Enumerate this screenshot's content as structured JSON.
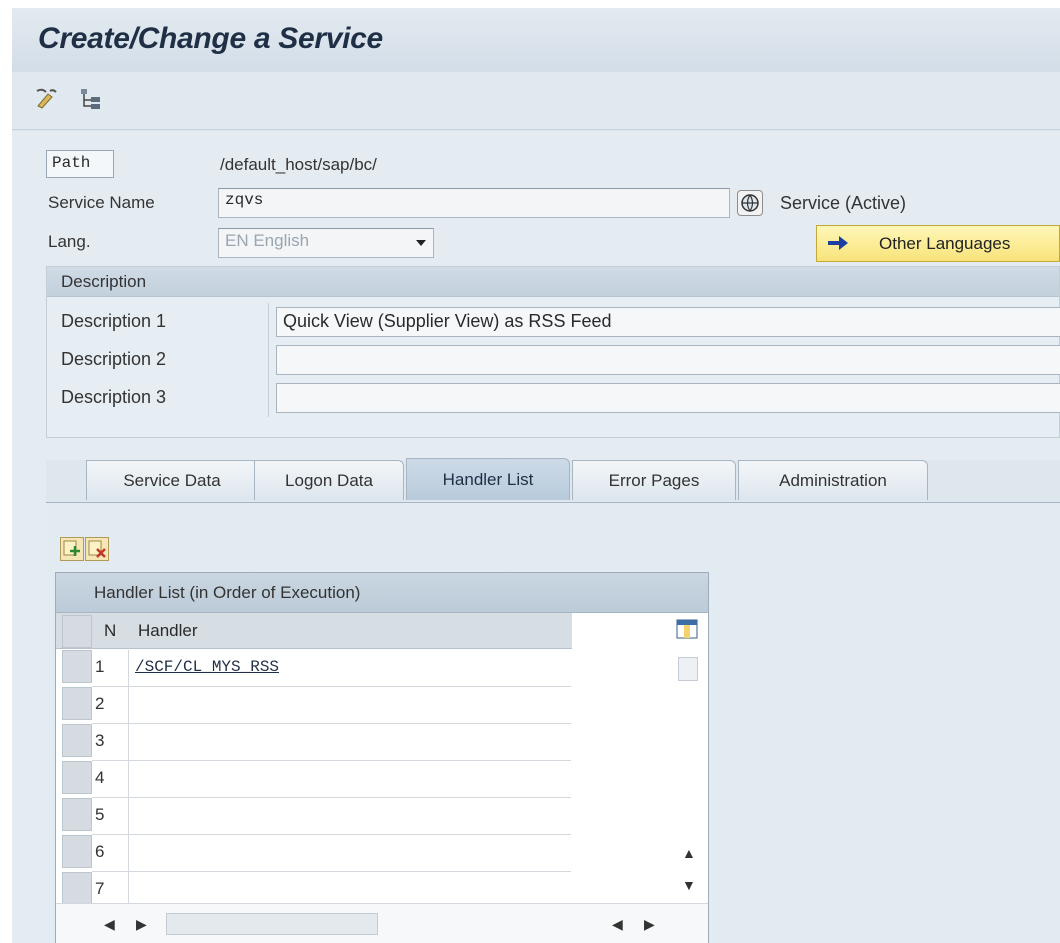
{
  "window": {
    "title": "Create/Change a Service"
  },
  "toolbar": {
    "icons": [
      "edit-pencil-icon",
      "hierarchy-icon"
    ]
  },
  "form": {
    "path_label": "Path",
    "path_value": "/default_host/sap/bc/",
    "service_name_label": "Service Name",
    "service_name_value": "zqvs",
    "service_status": "Service (Active)",
    "lang_label": "Lang.",
    "lang_value": "EN English",
    "other_languages_button": "Other Languages"
  },
  "description": {
    "header": "Description",
    "rows": [
      {
        "label": "Description 1",
        "value": "Quick View (Supplier View) as RSS Feed"
      },
      {
        "label": "Description 2",
        "value": ""
      },
      {
        "label": "Description 3",
        "value": ""
      }
    ]
  },
  "tabs": [
    {
      "label": "Service Data",
      "active": false
    },
    {
      "label": "Logon Data",
      "active": false
    },
    {
      "label": "Handler List",
      "active": true
    },
    {
      "label": "Error Pages",
      "active": false
    },
    {
      "label": "Administration",
      "active": false
    }
  ],
  "handler_table": {
    "title": "Handler List (in Order of Execution)",
    "columns": [
      "N",
      "Handler"
    ],
    "rows": [
      {
        "n": "1",
        "handler": "/SCF/CL_MYS_RSS"
      },
      {
        "n": "2",
        "handler": ""
      },
      {
        "n": "3",
        "handler": ""
      },
      {
        "n": "4",
        "handler": ""
      },
      {
        "n": "5",
        "handler": ""
      },
      {
        "n": "6",
        "handler": ""
      },
      {
        "n": "7",
        "handler": ""
      }
    ]
  }
}
